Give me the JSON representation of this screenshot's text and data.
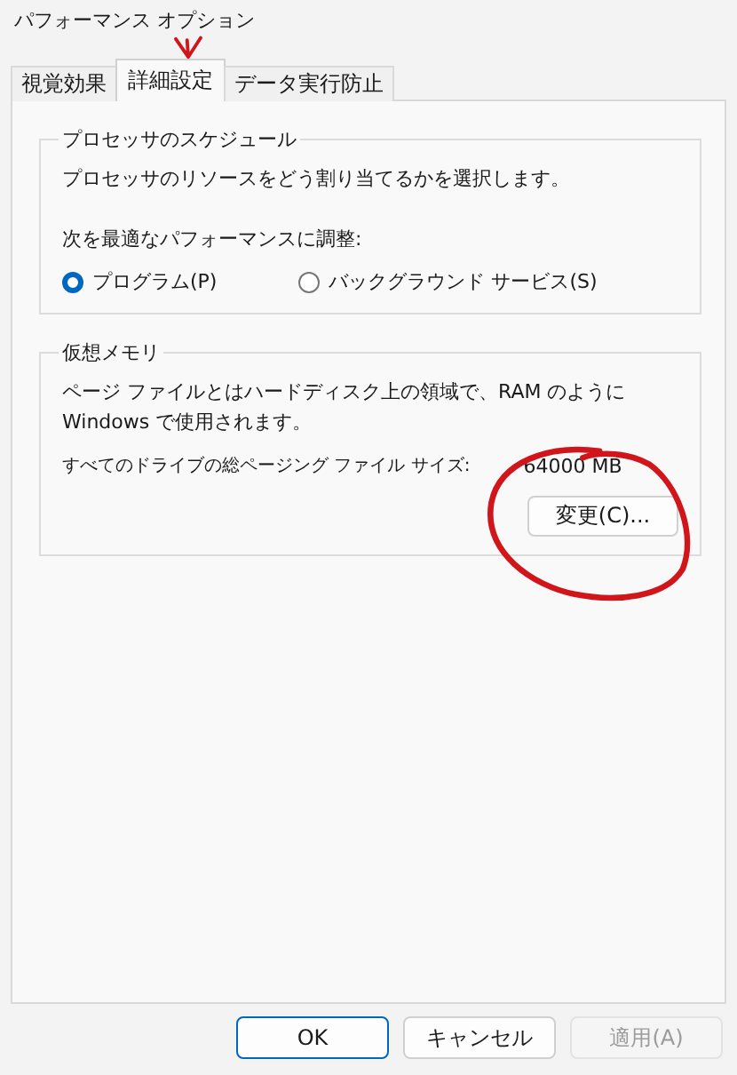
{
  "window": {
    "title": "パフォーマンス オプション"
  },
  "tabs": [
    {
      "label": "視覚効果",
      "selected": false
    },
    {
      "label": "詳細設定",
      "selected": true
    },
    {
      "label": "データ実行防止",
      "selected": false
    }
  ],
  "processor_scheduling": {
    "title": "プロセッサのスケジュール",
    "description": "プロセッサのリソースをどう割り当てるかを選択します。",
    "adjust_label": "次を最適なパフォーマンスに調整:",
    "options": [
      {
        "label": "プログラム(P)",
        "selected": true
      },
      {
        "label": "バックグラウンド サービス(S)",
        "selected": false
      }
    ]
  },
  "virtual_memory": {
    "title": "仮想メモリ",
    "description": "ページ ファイルとはハードディスク上の領域で、RAM のように Windows で使用されます。",
    "total_label": "すべてのドライブの総ページング ファイル サイズ:",
    "total_value": "64000 MB",
    "change_button": "変更(C)..."
  },
  "buttons": [
    {
      "label": "OK",
      "kind": "default",
      "disabled": false
    },
    {
      "label": "キャンセル",
      "kind": "normal",
      "disabled": false
    },
    {
      "label": "適用(A)",
      "kind": "normal",
      "disabled": true
    }
  ]
}
